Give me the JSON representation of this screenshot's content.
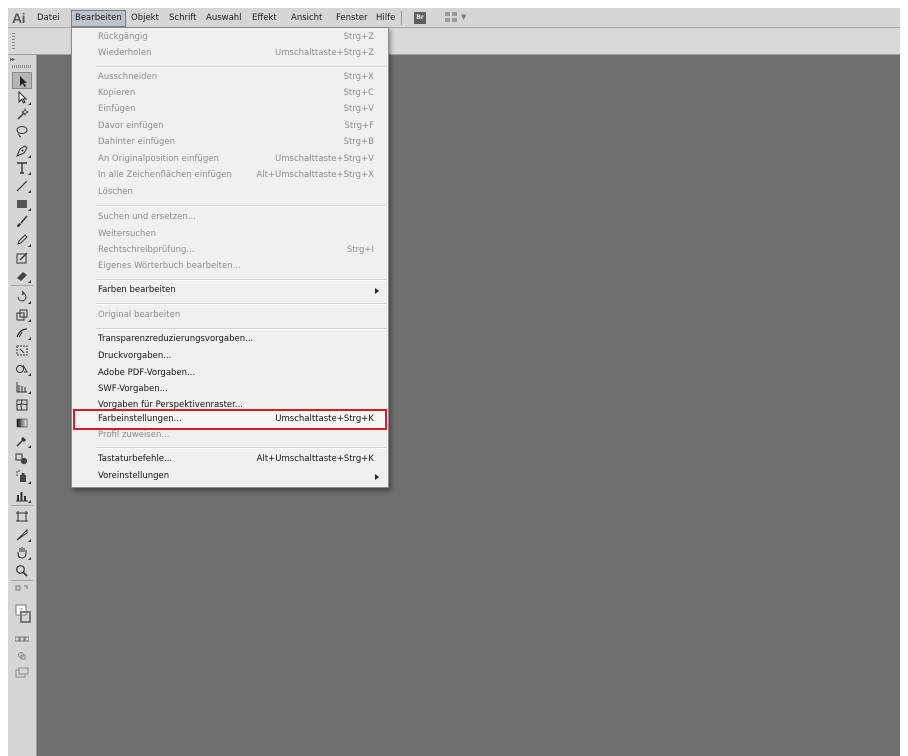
{
  "app": {
    "logo": "Ai"
  },
  "menubar": {
    "items": [
      "Datei",
      "Bearbeiten",
      "Objekt",
      "Schrift",
      "Auswahl",
      "Effekt",
      "Ansicht",
      "Fenster",
      "Hilfe"
    ],
    "active": "Bearbeiten",
    "bridge_label": "Br"
  },
  "menu": {
    "undo": {
      "label": "Rückgängig",
      "shortcut": "Strg+Z"
    },
    "redo": {
      "label": "Wiederholen",
      "shortcut": "Umschalttaste+Strg+Z"
    },
    "cut": {
      "label": "Ausschneiden",
      "shortcut": "Strg+X"
    },
    "copy": {
      "label": "Kopieren",
      "shortcut": "Strg+C"
    },
    "paste": {
      "label": "Einfügen",
      "shortcut": "Strg+V"
    },
    "paste_front": {
      "label": "Davor einfügen",
      "shortcut": "Strg+F"
    },
    "paste_back": {
      "label": "Dahinter einfügen",
      "shortcut": "Strg+B"
    },
    "paste_place": {
      "label": "An Originalposition einfügen",
      "shortcut": "Umschalttaste+Strg+V"
    },
    "paste_all": {
      "label": "In alle Zeichenflächen einfügen",
      "shortcut": "Alt+Umschalttaste+Strg+X"
    },
    "clear": {
      "label": "Löschen"
    },
    "find_replace": {
      "label": "Suchen und ersetzen..."
    },
    "find_next": {
      "label": "Weitersuchen"
    },
    "spelling": {
      "label": "Rechtschreibprüfung...",
      "shortcut": "Strg+I"
    },
    "dictionary": {
      "label": "Eigenes Wörterbuch bearbeiten..."
    },
    "edit_colors": {
      "label": "Farben bearbeiten"
    },
    "edit_original": {
      "label": "Original bearbeiten"
    },
    "transparency_presets": {
      "label": "Transparenzreduzierungsvorgaben..."
    },
    "print_presets": {
      "label": "Druckvorgaben..."
    },
    "pdf_presets": {
      "label": "Adobe PDF-Vorgaben..."
    },
    "swf_presets": {
      "label": "SWF-Vorgaben..."
    },
    "perspective_presets": {
      "label": "Vorgaben für Perspektivenraster..."
    },
    "color_settings": {
      "label": "Farbeinstellungen...",
      "shortcut": "Umschalttaste+Strg+K"
    },
    "assign_profile": {
      "label": "Profil zuweisen..."
    },
    "keyboard_shortcuts": {
      "label": "Tastaturbefehle...",
      "shortcut": "Alt+Umschalttaste+Strg+K"
    },
    "preferences": {
      "label": "Voreinstellungen"
    }
  },
  "colors": {
    "highlight_border": "#d9191f",
    "canvas": "#6e6e6e",
    "menubar": "#d6d6d6"
  },
  "tools": [
    "selection-tool-icon",
    "direct-selection-tool-icon",
    "magic-wand-tool-icon",
    "lasso-tool-icon",
    "pen-tool-icon",
    "type-tool-icon",
    "line-segment-tool-icon",
    "rectangle-tool-icon",
    "paintbrush-tool-icon",
    "pencil-tool-icon",
    "blob-brush-tool-icon",
    "eraser-tool-icon",
    "rotate-tool-icon",
    "scale-tool-icon",
    "warp-tool-icon",
    "free-transform-tool-icon",
    "shape-builder-tool-icon",
    "perspective-grid-tool-icon",
    "mesh-tool-icon",
    "gradient-tool-icon",
    "eyedropper-tool-icon",
    "blend-tool-icon",
    "symbol-sprayer-tool-icon",
    "column-graph-tool-icon",
    "artboard-tool-icon",
    "slice-tool-icon",
    "hand-tool-icon",
    "zoom-tool-icon"
  ]
}
